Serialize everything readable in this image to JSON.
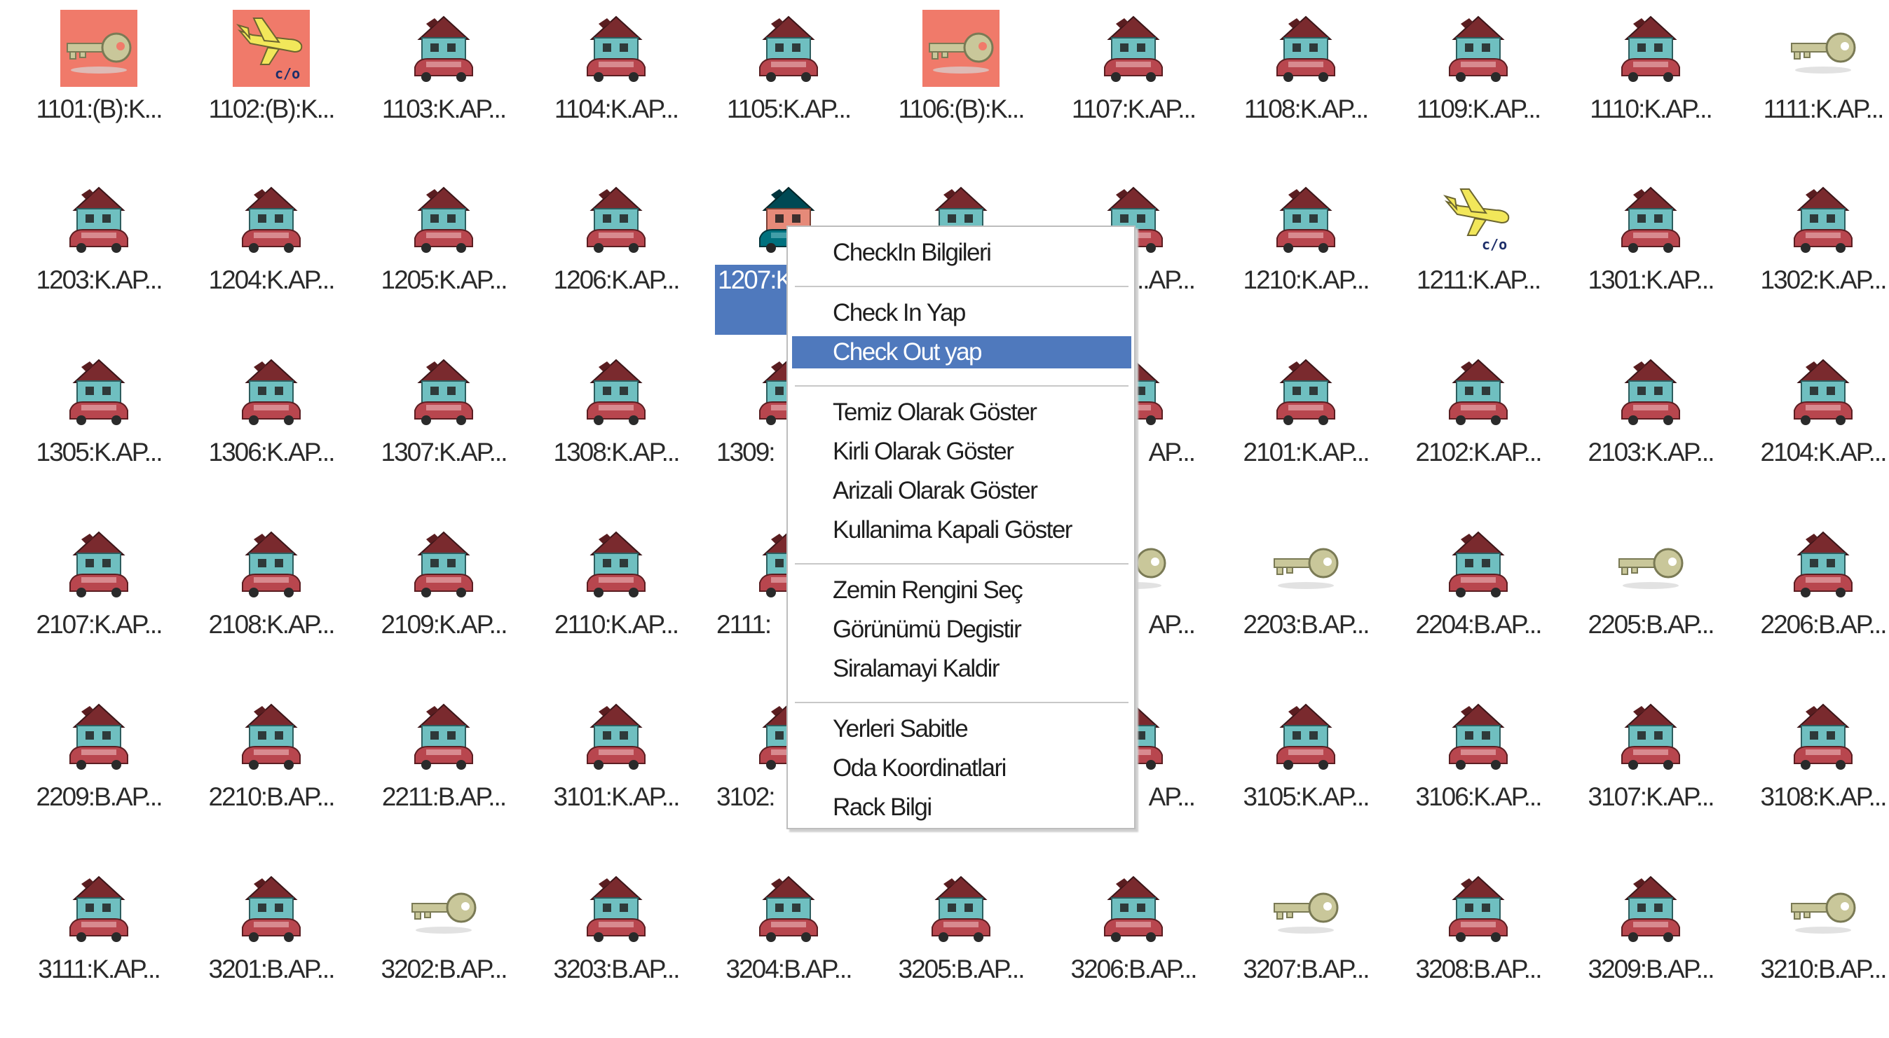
{
  "rows": [
    [
      {
        "label": "1101:(B):K...",
        "icon": "checkout-key-icon"
      },
      {
        "label": "1102:(B):K...",
        "icon": "checkin-plane-icon"
      },
      {
        "label": "1103:K.AP...",
        "icon": "house-car-icon"
      },
      {
        "label": "1104:K.AP...",
        "icon": "house-car-icon"
      },
      {
        "label": "1105:K.AP...",
        "icon": "house-car-icon"
      },
      {
        "label": "1106:(B):K...",
        "icon": "checkout-key-icon"
      },
      {
        "label": "1107:K.AP...",
        "icon": "house-car-icon"
      },
      {
        "label": "1108:K.AP...",
        "icon": "house-car-icon"
      },
      {
        "label": "1109:K.AP...",
        "icon": "house-car-icon"
      },
      {
        "label": "1110:K.AP...",
        "icon": "house-car-icon"
      },
      {
        "label": "1111:K.AP...",
        "icon": "key-icon"
      }
    ],
    [
      {
        "label": "1203:K.AP...",
        "icon": "house-car-icon"
      },
      {
        "label": "1204:K.AP...",
        "icon": "house-car-icon"
      },
      {
        "label": "1205:K.AP...",
        "icon": "house-car-icon"
      },
      {
        "label": "1206:K.AP...",
        "icon": "house-car-icon"
      },
      {
        "label": "1207:K",
        "icon": "house-car-icon",
        "selected": true
      },
      {
        "label": "",
        "icon": "house-car-icon",
        "covered": true
      },
      {
        "label": "...AP...",
        "icon": "house-car-icon",
        "partial": true
      },
      {
        "label": "1210:K.AP...",
        "icon": "house-car-icon"
      },
      {
        "label": "1211:K.AP...",
        "icon": "checkin-plane-icon"
      },
      {
        "label": "1301:K.AP...",
        "icon": "house-car-icon"
      },
      {
        "label": "1302:K.AP...",
        "icon": "house-car-icon"
      }
    ],
    [
      {
        "label": "1305:K.AP...",
        "icon": "house-car-icon"
      },
      {
        "label": "1306:K.AP...",
        "icon": "house-car-icon"
      },
      {
        "label": "1307:K.AP...",
        "icon": "house-car-icon"
      },
      {
        "label": "1308:K.AP...",
        "icon": "house-car-icon"
      },
      {
        "label": "1309:",
        "icon": "house-car-icon",
        "partial": true
      },
      {
        "label": "",
        "icon": "house-car-icon",
        "covered": true
      },
      {
        "label": "AP...",
        "icon": "house-car-icon",
        "partial": true
      },
      {
        "label": "2101:K.AP...",
        "icon": "house-car-icon"
      },
      {
        "label": "2102:K.AP...",
        "icon": "house-car-icon"
      },
      {
        "label": "2103:K.AP...",
        "icon": "house-car-icon"
      },
      {
        "label": "2104:K.AP...",
        "icon": "house-car-icon"
      }
    ],
    [
      {
        "label": "2107:K.AP...",
        "icon": "house-car-icon"
      },
      {
        "label": "2108:K.AP...",
        "icon": "house-car-icon"
      },
      {
        "label": "2109:K.AP...",
        "icon": "house-car-icon"
      },
      {
        "label": "2110:K.AP...",
        "icon": "house-car-icon"
      },
      {
        "label": "2111:",
        "icon": "house-car-icon",
        "partial": true
      },
      {
        "label": "",
        "icon": "house-car-icon",
        "covered": true
      },
      {
        "label": "AP...",
        "icon": "key-icon",
        "partial": true
      },
      {
        "label": "2203:B.AP...",
        "icon": "key-icon"
      },
      {
        "label": "2204:B.AP...",
        "icon": "house-car-icon"
      },
      {
        "label": "2205:B.AP...",
        "icon": "key-icon"
      },
      {
        "label": "2206:B.AP...",
        "icon": "house-car-icon"
      }
    ],
    [
      {
        "label": "2209:B.AP...",
        "icon": "house-car-icon"
      },
      {
        "label": "2210:B.AP...",
        "icon": "house-car-icon"
      },
      {
        "label": "2211:B.AP...",
        "icon": "house-car-icon"
      },
      {
        "label": "3101:K.AP...",
        "icon": "house-car-icon"
      },
      {
        "label": "3102:",
        "icon": "house-car-icon",
        "partial": true
      },
      {
        "label": "",
        "icon": "house-car-icon",
        "covered": true
      },
      {
        "label": "AP...",
        "icon": "house-car-icon",
        "partial": true
      },
      {
        "label": "3105:K.AP...",
        "icon": "house-car-icon"
      },
      {
        "label": "3106:K.AP...",
        "icon": "house-car-icon"
      },
      {
        "label": "3107:K.AP...",
        "icon": "house-car-icon"
      },
      {
        "label": "3108:K.AP...",
        "icon": "house-car-icon"
      }
    ],
    [
      {
        "label": "3111:K.AP...",
        "icon": "house-car-icon"
      },
      {
        "label": "3201:B.AP...",
        "icon": "house-car-icon"
      },
      {
        "label": "3202:B.AP...",
        "icon": "key-icon"
      },
      {
        "label": "3203:B.AP...",
        "icon": "house-car-icon"
      },
      {
        "label": "3204:B.AP...",
        "icon": "house-car-icon"
      },
      {
        "label": "3205:B.AP...",
        "icon": "house-car-icon"
      },
      {
        "label": "3206:B.AP...",
        "icon": "house-car-icon"
      },
      {
        "label": "3207:B.AP...",
        "icon": "key-icon"
      },
      {
        "label": "3208:B.AP...",
        "icon": "house-car-icon"
      },
      {
        "label": "3209:B.AP...",
        "icon": "house-car-icon"
      },
      {
        "label": "3210:B.AP...",
        "icon": "key-icon"
      }
    ]
  ],
  "context_menu": {
    "groups": [
      [
        "CheckIn Bilgileri"
      ],
      [
        "Check In Yap",
        "Check Out yap"
      ],
      [
        "Temiz Olarak Göster",
        "Kirli Olarak Göster",
        "Arizali Olarak Göster",
        "Kullanima Kapali Göster"
      ],
      [
        "Zemin Rengini Seç",
        "Görünümü Degistir",
        "Siralamayi Kaldir"
      ],
      [
        "Yerleri Sabitle",
        "Oda Koordinatlari",
        "Rack Bilgi"
      ]
    ],
    "highlighted": "Check Out yap"
  },
  "colors": {
    "selection": "#4f79bd",
    "checkout_background": "#f07a6a",
    "roof": "#7a2a2e",
    "house_wall": "#6fbfc0",
    "car": "#b8464e",
    "key": "#c9c79a",
    "plane": "#f2e75a"
  }
}
